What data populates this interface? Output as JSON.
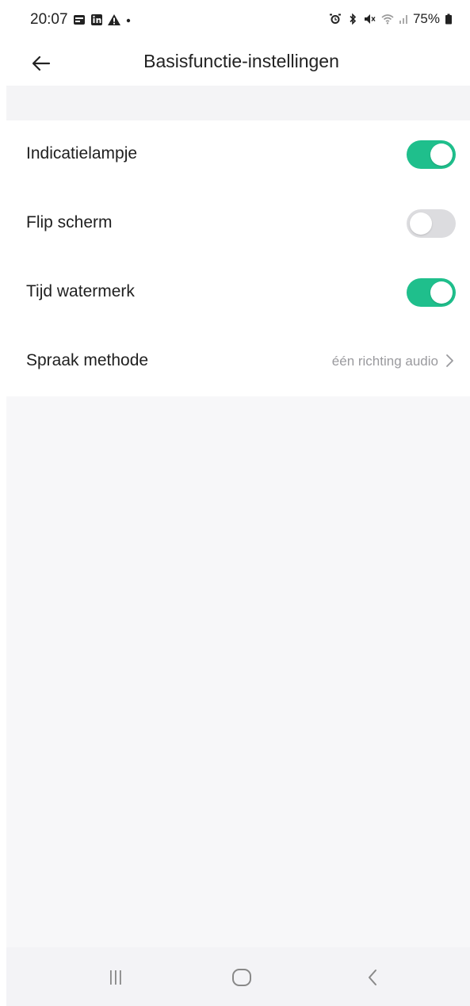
{
  "status_bar": {
    "time": "20:07",
    "battery": "75%",
    "left_icons": [
      "gallery-icon",
      "linkedin-icon",
      "warning-icon",
      "dot-icon"
    ],
    "right_icons": [
      "alarm-icon",
      "bluetooth-icon",
      "mute-icon",
      "wifi-icon",
      "signal-icon",
      "battery-icon"
    ]
  },
  "header": {
    "title": "Basisfunctie-instellingen"
  },
  "settings": {
    "items": [
      {
        "label": "Indicatielampje",
        "type": "toggle",
        "on": true
      },
      {
        "label": "Flip scherm",
        "type": "toggle",
        "on": false
      },
      {
        "label": "Tijd watermerk",
        "type": "toggle",
        "on": true
      },
      {
        "label": "Spraak methode",
        "type": "select",
        "value": "één richting audio"
      }
    ]
  },
  "colors": {
    "accent": "#1fbf8c",
    "toggle_off": "#dcdcdf",
    "background": "#f7f7f9"
  }
}
